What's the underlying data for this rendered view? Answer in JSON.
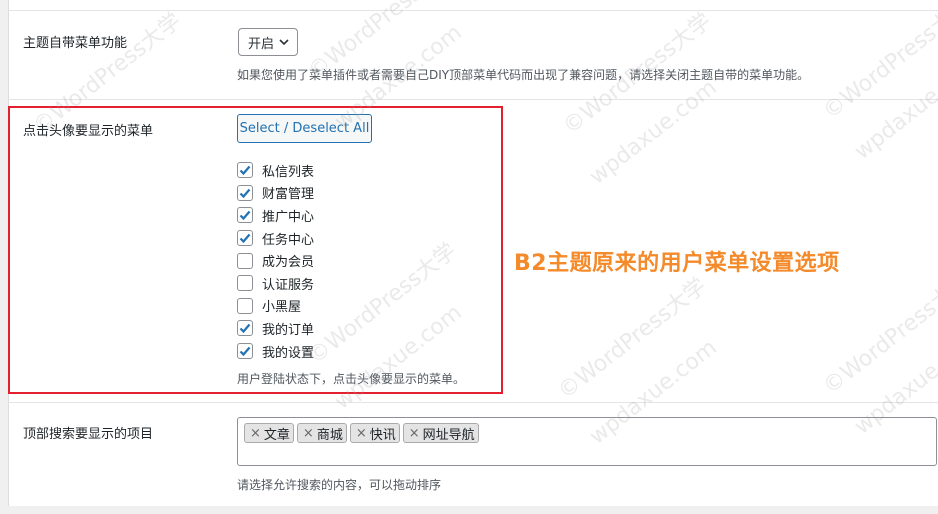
{
  "menu_toggle": {
    "label": "主题自带菜单功能",
    "selected": "开启",
    "description": "如果您使用了菜单插件或者需要自己DIY顶部菜单代码而出现了兼容问题，请选择关闭主题自带的菜单功能。"
  },
  "avatar_menu": {
    "label": "点击头像要显示的菜单",
    "select_all_label": "Select / Deselect All",
    "items": [
      {
        "label": "私信列表",
        "checked": true
      },
      {
        "label": "财富管理",
        "checked": true
      },
      {
        "label": "推广中心",
        "checked": true
      },
      {
        "label": "任务中心",
        "checked": true
      },
      {
        "label": "成为会员",
        "checked": false
      },
      {
        "label": "认证服务",
        "checked": false
      },
      {
        "label": "小黑屋",
        "checked": false
      },
      {
        "label": "我的订单",
        "checked": true
      },
      {
        "label": "我的设置",
        "checked": true
      }
    ],
    "description": "用户登陆状态下，点击头像要显示的菜单。"
  },
  "annotation": "B2主题原来的用户菜单设置选项",
  "search_items": {
    "label": "顶部搜索要显示的项目",
    "tags": [
      {
        "x": "×",
        "label": "文章"
      },
      {
        "x": "×",
        "label": "商城"
      },
      {
        "x": "×",
        "label": "快讯"
      },
      {
        "x": "×",
        "label": "网址导航"
      }
    ],
    "description": "请选择允许搜索的内容，可以拖动排序"
  },
  "watermark": {
    "brand": "©WordPress大学",
    "domain": "wpdaxue.com"
  },
  "colors": {
    "accent": "#2271b1",
    "highlight_box": "#e5202e",
    "annotation": "#f48a2a"
  }
}
